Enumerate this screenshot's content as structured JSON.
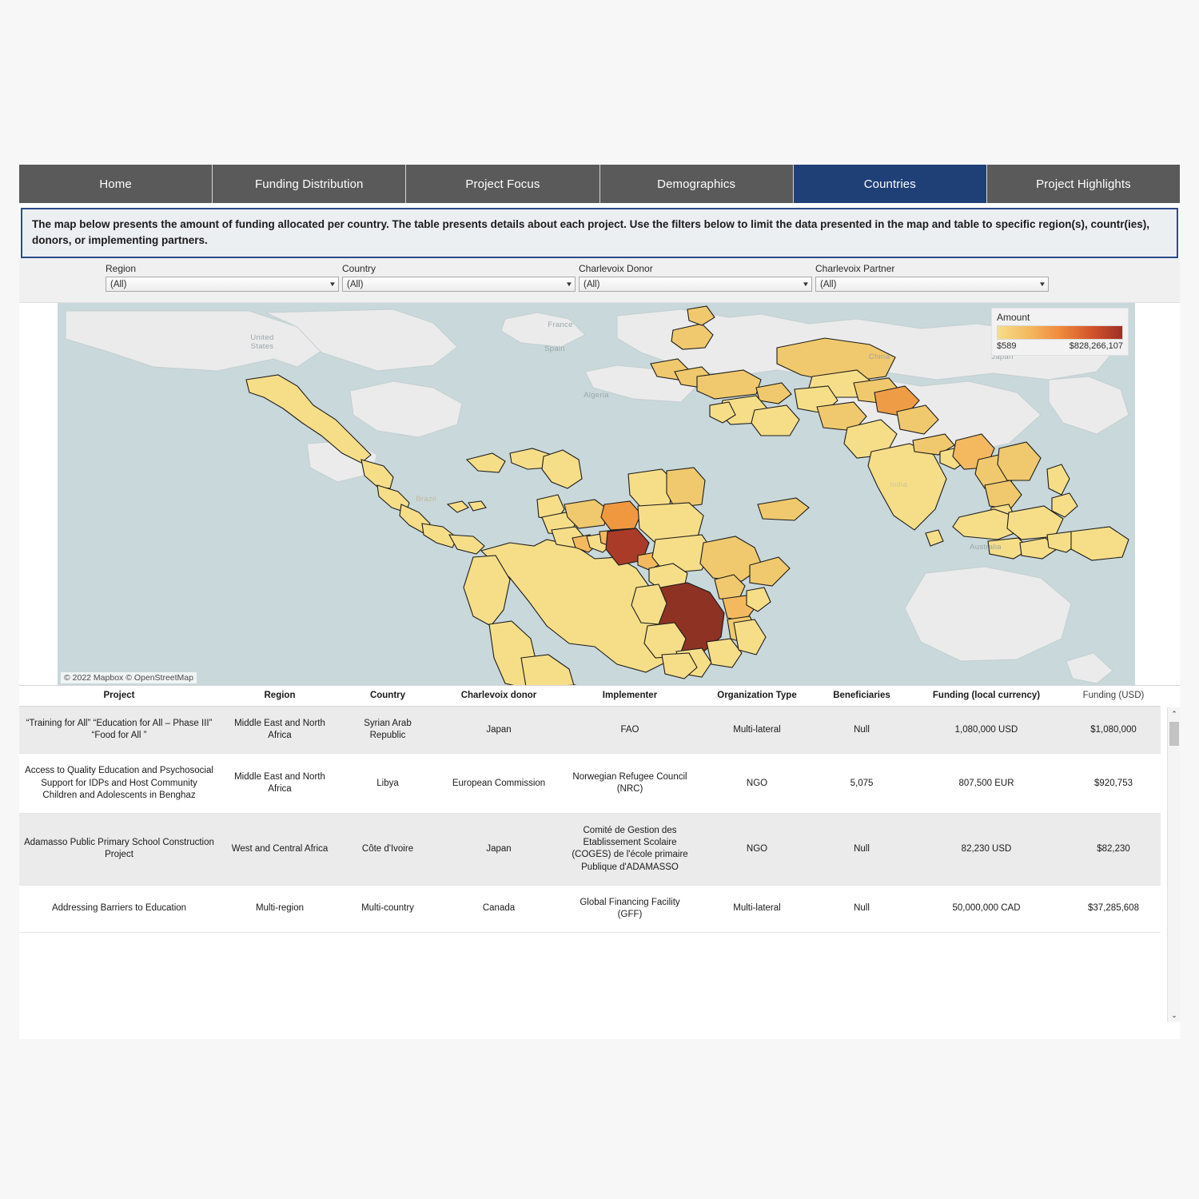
{
  "tabs": [
    {
      "label": "Home",
      "active": false
    },
    {
      "label": "Funding Distribution",
      "active": false
    },
    {
      "label": "Project Focus",
      "active": false
    },
    {
      "label": "Demographics",
      "active": false
    },
    {
      "label": "Countries",
      "active": true
    },
    {
      "label": "Project Highlights",
      "active": false
    }
  ],
  "banner": {
    "text": "The map below presents the amount of funding allocated per country. The table presents details about each project. Use the filters below to limit the data presented in the map and table to specific region(s), countr(ies), donors, or implementing partners."
  },
  "filters": [
    {
      "label": "Region",
      "value": "(All)",
      "name": "region"
    },
    {
      "label": "Country",
      "value": "(All)",
      "name": "country"
    },
    {
      "label": "Charlevoix Donor",
      "value": "(All)",
      "name": "charlevoix-donor"
    },
    {
      "label": "Charlevoix Partner",
      "value": "(All)",
      "name": "charlevoix-partner"
    }
  ],
  "map": {
    "attribution": "© 2022 Mapbox  © OpenStreetMap",
    "labels": [
      "France",
      "Spain",
      "Algeria",
      "United States",
      "Brazil",
      "China",
      "Japan",
      "India",
      "Australia"
    ],
    "legend": {
      "title": "Amount",
      "min": "$589",
      "max": "$828,266,107",
      "ramp_start": "#f6da79",
      "ramp_mid": "#ef8a3c",
      "ramp_end": "#9e3024"
    },
    "ocean_color": "#c9d8da",
    "no_data_color": "#ebebeb"
  },
  "table": {
    "columns": [
      {
        "label": "Project",
        "muted": false
      },
      {
        "label": "Region",
        "muted": false
      },
      {
        "label": "Country",
        "muted": false
      },
      {
        "label": "Charlevoix donor",
        "muted": false
      },
      {
        "label": "Implementer",
        "muted": false
      },
      {
        "label": "Organization Type",
        "muted": false
      },
      {
        "label": "Beneficiaries",
        "muted": false
      },
      {
        "label": "Funding (local currency)",
        "muted": false
      },
      {
        "label": "Funding (USD)",
        "muted": true
      }
    ],
    "rows": [
      {
        "project": "“Training for All”  “Education for All – Phase III”  “Food for All ”",
        "region": "Middle East and North Africa",
        "country": "Syrian Arab Republic",
        "donor": "Japan",
        "implementer": "FAO",
        "org_type": "Multi-lateral",
        "beneficiaries": "Null",
        "funding_local": "1,080,000 USD",
        "funding_usd": "$1,080,000"
      },
      {
        "project": "Access to Quality Education and Psychosocial Support for IDPs and Host Community Children and Adolescents in Benghaz",
        "region": "Middle East and North Africa",
        "country": "Libya",
        "donor": "European Commission",
        "implementer": "Norwegian Refugee Council (NRC)",
        "org_type": "NGO",
        "beneficiaries": "5,075",
        "funding_local": "807,500 EUR",
        "funding_usd": "$920,753"
      },
      {
        "project": "Adamasso Public Primary School Construction Project",
        "region": "West and Central Africa",
        "country": "Côte d'Ivoire",
        "donor": "Japan",
        "implementer": "Comité de Gestion des Etablissement Scolaire (COGES) de l'école primaire Publique d'ADAMASSO",
        "org_type": "NGO",
        "beneficiaries": "Null",
        "funding_local": "82,230 USD",
        "funding_usd": "$82,230"
      },
      {
        "project": "Addressing Barriers to Education",
        "region": "Multi-region",
        "country": "Multi-country",
        "donor": "Canada",
        "implementer": "Global Financing Facility (GFF)",
        "org_type": "Multi-lateral",
        "beneficiaries": "Null",
        "funding_local": "50,000,000 CAD",
        "funding_usd": "$37,285,608"
      }
    ]
  },
  "scrollbar": {
    "up_glyph": "⌃",
    "down_glyph": "⌄"
  }
}
